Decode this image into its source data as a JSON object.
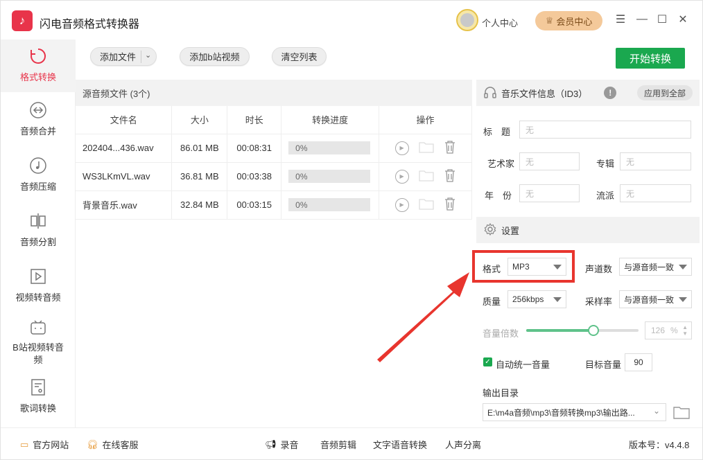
{
  "app": {
    "title": "闪电音频格式转换器",
    "logo_glyph": "♪"
  },
  "header": {
    "user_center": "个人中心",
    "vip_center": "会员中心"
  },
  "sidebar": {
    "items": [
      {
        "label": "格式转换",
        "icon": "refresh-icon"
      },
      {
        "label": "音频合并",
        "icon": "merge-icon"
      },
      {
        "label": "音频压缩",
        "icon": "music-note-icon"
      },
      {
        "label": "音频分割",
        "icon": "split-icon"
      },
      {
        "label": "视频转音频",
        "icon": "video-audio-icon"
      },
      {
        "label": "B站视频转音频",
        "icon": "bilibili-icon"
      },
      {
        "label": "歌词转换",
        "icon": "lyrics-icon"
      }
    ]
  },
  "toolbar": {
    "add_file": "添加文件",
    "add_bilibili": "添加b站视频",
    "clear_list": "清空列表",
    "start": "开始转换"
  },
  "files": {
    "header": "源音频文件 (3个)",
    "columns": [
      "文件名",
      "大小",
      "时长",
      "转换进度",
      "操作"
    ],
    "rows": [
      {
        "name": "202404...436.wav",
        "size": "86.01 MB",
        "duration": "00:08:31",
        "progress": "0%"
      },
      {
        "name": "WS3LKmVL.wav",
        "size": "36.81 MB",
        "duration": "00:03:38",
        "progress": "0%"
      },
      {
        "name": "背景音乐.wav",
        "size": "32.84 MB",
        "duration": "00:03:15",
        "progress": "0%"
      }
    ]
  },
  "id3": {
    "header": "音乐文件信息（ID3）",
    "apply_all": "应用到全部",
    "title_label": "标　题",
    "artist_label": "艺术家",
    "album_label": "专辑",
    "year_label": "年　份",
    "genre_label": "流派",
    "empty_placeholder": "无"
  },
  "settings": {
    "header": "设置",
    "format_label": "格式",
    "format_value": "MP3",
    "channel_label": "声道数",
    "channel_value": "与源音频一致",
    "quality_label": "质量",
    "quality_value": "256kbps",
    "samplerate_label": "采样率",
    "samplerate_value": "与源音频一致",
    "volume_label": "音量倍数",
    "volume_value": "126",
    "volume_unit": "%",
    "volume_level": 0.6,
    "auto_volume_label": "自动统一音量",
    "target_volume_label": "目标音量",
    "target_volume_value": "90",
    "output_label": "输出目录",
    "output_path": "E:\\m4a音频\\mp3\\音频转换mp3\\输出路..."
  },
  "footer": {
    "website": "官方网站",
    "service": "在线客服",
    "record": "录音",
    "edit": "音频剪辑",
    "tts": "文字语音转换",
    "vocal": "人声分离",
    "version": "版本号：v4.4.8"
  },
  "colors": {
    "accent": "#e8344a",
    "start_green": "#1aa84f",
    "highlight": "#e8352e"
  }
}
